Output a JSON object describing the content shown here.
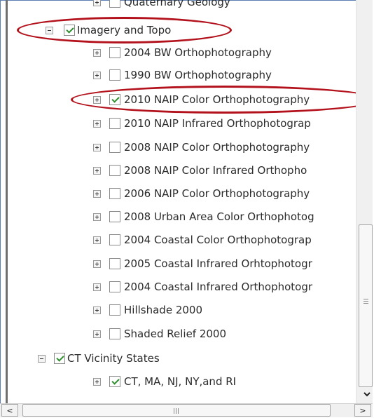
{
  "tree": {
    "rows": [
      {
        "label": "Quaternary Geology",
        "checked": false,
        "expander": "plus"
      },
      {
        "label": "Imagery and Topo",
        "checked": true,
        "expander": "minus"
      },
      {
        "label": "2004 BW Orthophotography",
        "checked": false,
        "expander": "plus"
      },
      {
        "label": "1990 BW Orthophotography",
        "checked": false,
        "expander": "plus"
      },
      {
        "label": "2010 NAIP Color Orthophotography",
        "checked": true,
        "expander": "plus"
      },
      {
        "label": "2010 NAIP Infrared Orthophotograp",
        "checked": false,
        "expander": "plus"
      },
      {
        "label": "2008 NAIP Color Orthophotography",
        "checked": false,
        "expander": "plus"
      },
      {
        "label": "2008 NAIP Color Infrared Orthopho",
        "checked": false,
        "expander": "plus"
      },
      {
        "label": "2006 NAIP Color Orthophotography",
        "checked": false,
        "expander": "plus"
      },
      {
        "label": "2008 Urban Area Color Orthophotog",
        "checked": false,
        "expander": "plus"
      },
      {
        "label": "2004 Coastal Color Orthophotograp",
        "checked": false,
        "expander": "plus"
      },
      {
        "label": "2005 Coastal Infrared Orhtophotogr",
        "checked": false,
        "expander": "plus"
      },
      {
        "label": "2004 Coastal Infrared Orthophotogr",
        "checked": false,
        "expander": "plus"
      },
      {
        "label": "Hillshade 2000",
        "checked": false,
        "expander": "plus"
      },
      {
        "label": "Shaded Relief 2000",
        "checked": false,
        "expander": "plus"
      },
      {
        "label": "CT Vicinity States",
        "checked": true,
        "expander": "minus"
      },
      {
        "label": "CT, MA, NJ, NY,and RI",
        "checked": true,
        "expander": "plus"
      }
    ]
  },
  "scrollbars": {
    "left_arrow": "<",
    "right_arrow": ">",
    "down_arrow": "v"
  },
  "colors": {
    "highlight_oval": "#b3121c",
    "checkmark": "#2f8f2f",
    "frame_border": "#5b7fb3"
  }
}
